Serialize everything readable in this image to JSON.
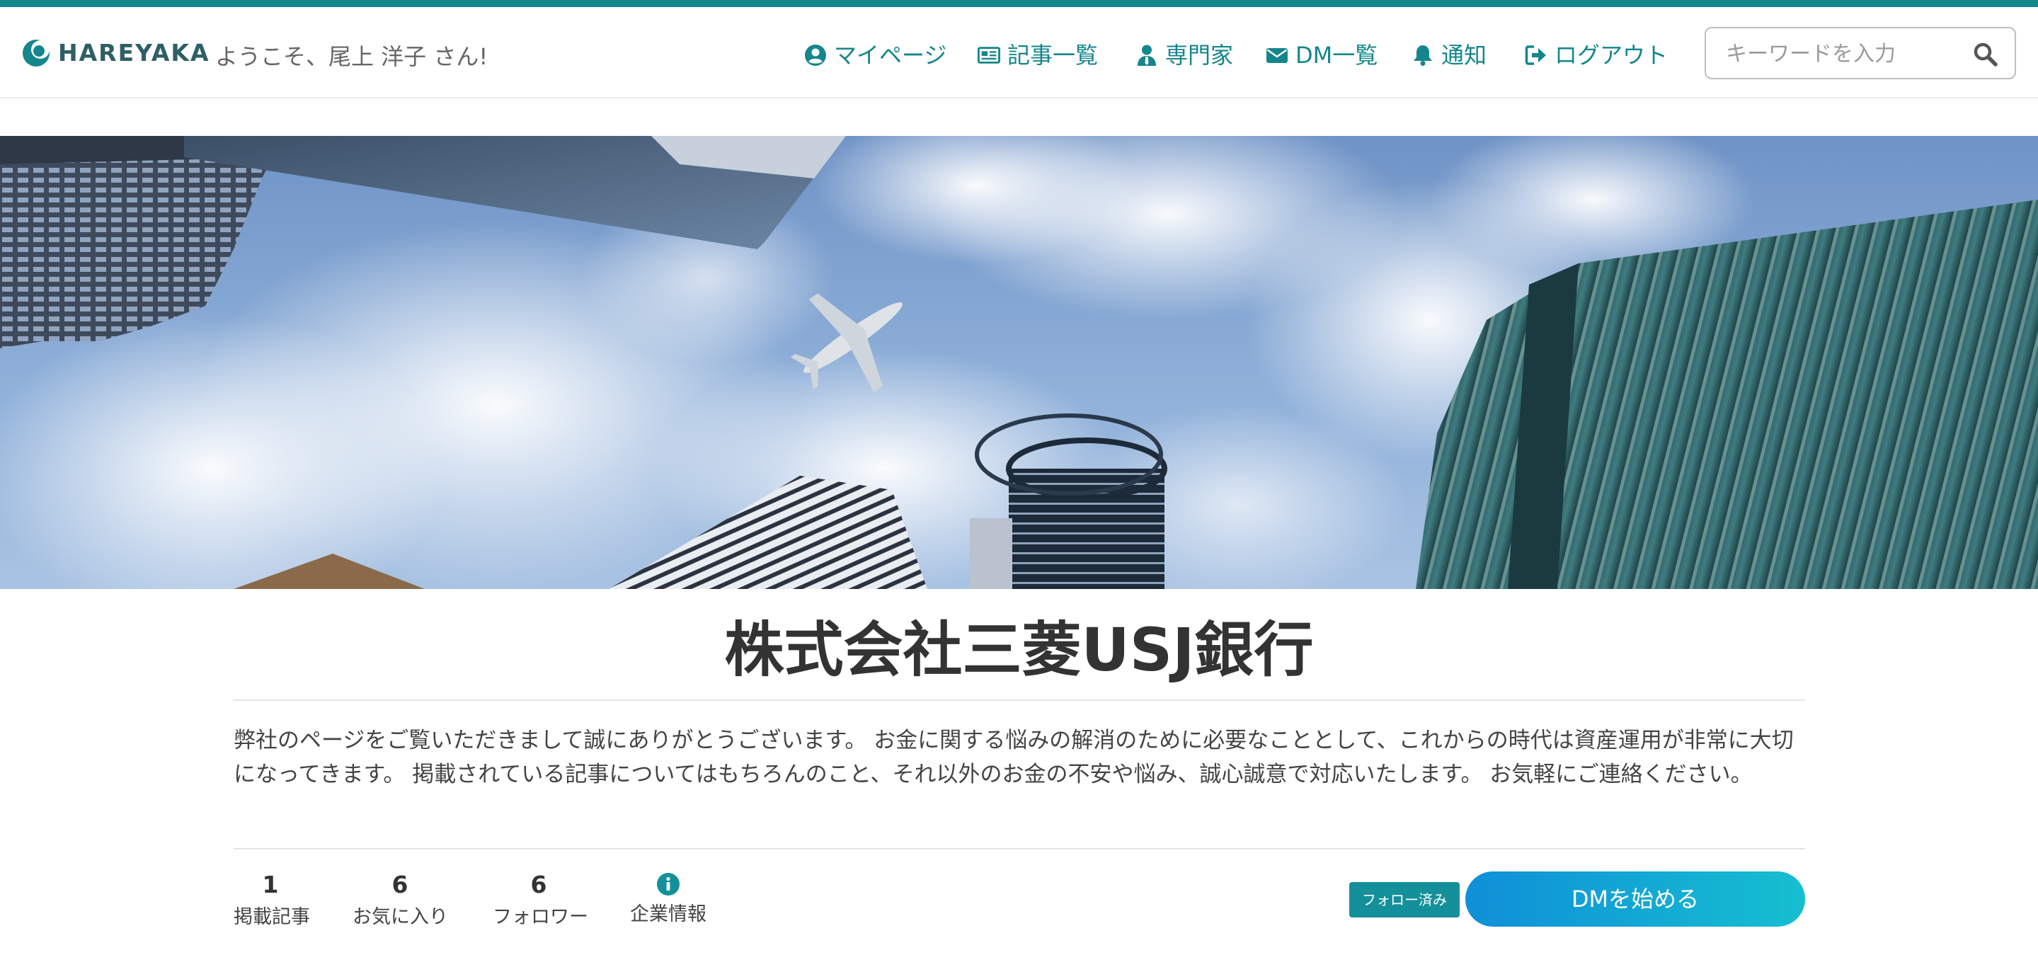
{
  "brand": {
    "name": "HAREYAKA",
    "accent_color": "#14868c"
  },
  "header": {
    "welcome": "ようこそ、尾上 洋子 さん!",
    "nav": [
      {
        "label": "マイページ",
        "icon": "user-circle-icon"
      },
      {
        "label": "記事一覧",
        "icon": "newspaper-icon"
      },
      {
        "label": "専門家",
        "icon": "user-tie-icon"
      },
      {
        "label": "DM一覧",
        "icon": "envelope-icon"
      },
      {
        "label": "通知",
        "icon": "bell-icon"
      },
      {
        "label": "ログアウト",
        "icon": "sign-out-icon"
      }
    ],
    "search": {
      "placeholder": "キーワードを入力",
      "value": "",
      "icon": "search-icon"
    }
  },
  "hero": {
    "description": "cityscape photo with skyscrapers, clouds and airplane"
  },
  "company": {
    "name": "株式会社三菱USJ銀行",
    "description": "弊社のページをご覧いただきまして誠にありがとうございます。 お金に関する悩みの解消のために必要なこととして、これからの時代は資産運用が非常に大切になってきます。 掲載されている記事についてはもちろんのこと、それ以外のお金の不安や悩み、誠心誠意で対応いたします。 お気軽にご連絡ください。"
  },
  "stats": [
    {
      "value": "1",
      "label": "掲載記事"
    },
    {
      "value": "6",
      "label": "お気に入り"
    },
    {
      "value": "6",
      "label": "フォロワー"
    },
    {
      "label": "企業情報",
      "icon": "info-circle-icon"
    }
  ],
  "actions": {
    "follow_label": "フォロー済み",
    "dm_label": "DMを始める"
  }
}
